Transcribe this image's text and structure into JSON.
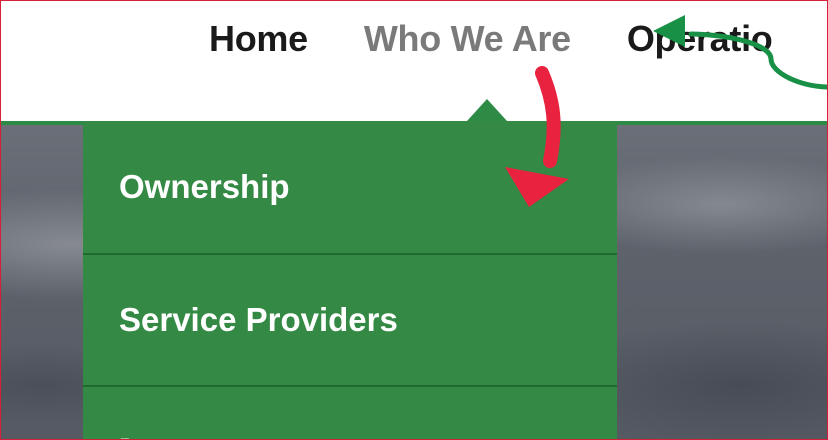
{
  "nav": {
    "items": [
      "Home",
      "Who We Are",
      "Operatio"
    ]
  },
  "dropdown": {
    "items": [
      "Ownership",
      "Service Providers",
      "..."
    ]
  },
  "colors": {
    "brand_green": "#2e8b45",
    "dropdown_green": "#348a44",
    "annotation_red": "#e8223f",
    "annotation_green": "#189046",
    "active_nav": "#7a7a7a"
  }
}
